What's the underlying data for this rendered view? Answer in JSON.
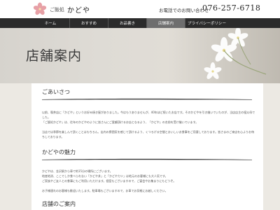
{
  "header": {
    "logo_sub": "ご飯処",
    "logo_name": "かどや",
    "phone_label": "お電話でのお問い合わせ",
    "phone_number": "076-257-6718"
  },
  "nav": {
    "items": [
      {
        "label": "ホーム"
      },
      {
        "label": "おすすめ"
      },
      {
        "label": "お品書き"
      },
      {
        "label": "店舗案内"
      },
      {
        "label": "プライバシーポリシー"
      }
    ]
  },
  "hero": {
    "title": "店舗案内"
  },
  "sections": {
    "greeting": {
      "heading": "ごあいさつ",
      "lines": [
        "以前、喫茶店に「かどや」というお好み焼き屋がありました。今はもうありませんが、40年ほど続いたお店です。そのかどやを引き継いでいたのが、当店店主の祖父母でした。",
        "「ご飯処かどや」は、往年のかどやのように皆さんにご愛顧頂けるお店となるよう、「かどや」の名前を受け継いでいます。",
        "当店では季節を楽しんで頂くことはもちろん、店内の雰囲気を感じて頂けるよう、くつろげる空間とおいしいお食事をご用意しております。皆さまのご来店を心よりお待ちしております。"
      ]
    },
    "charm": {
      "heading": "かどやの魅力",
      "lines": [
        "かどやは、金沢駅から車で約15分の場所にございます。",
        "地産地消、ここでしか食べられない「かどや丼」と「かどやカツ」は地元のお客様にも大人気です。",
        "ご家族やご友人との食事にもご利用いただけます。個室もございますので、ご宴会やお集まりにもどうぞ。",
        "お子様連れのお客様も歓迎いたします。駐車場もございますので、お車でお気軽にお越しください。"
      ]
    },
    "info": {
      "heading": "店舗のご案内"
    }
  }
}
